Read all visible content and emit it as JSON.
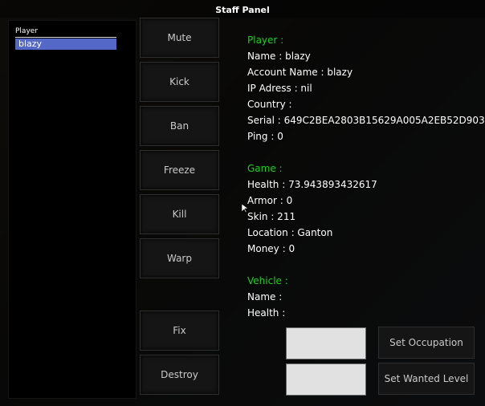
{
  "window": {
    "title": "Staff Panel"
  },
  "player_list": {
    "header": "Player",
    "rows": [
      "blazy"
    ]
  },
  "actions": [
    "Mute",
    "Kick",
    "Ban",
    "Freeze",
    "Kill",
    "Warp",
    "Fix",
    "Destroy"
  ],
  "info": {
    "player_heading": "Player :",
    "player_lines": [
      "Name : blazy",
      "Account Name : blazy",
      "IP Adress : nil",
      "Country :",
      "Serial : 649C2BEA2803B15629A005A2EB52D903",
      "Ping : 0"
    ],
    "game_heading": "Game :",
    "game_lines": [
      "Health : 73.943893432617",
      "Armor : 0",
      "Skin : 211",
      "Location : Ganton",
      "Money : 0"
    ],
    "vehicle_heading": "Vehicle :",
    "vehicle_lines": [
      "Name :",
      "Health :"
    ]
  },
  "occupation_input": {
    "value": ""
  },
  "wanted_input": {
    "value": ""
  },
  "buttons": {
    "set_occupation": "Set Occupation",
    "set_wanted": "Set Wanted Level"
  },
  "colors": {
    "section_heading": "#19d219",
    "selection": "#5468c8"
  }
}
